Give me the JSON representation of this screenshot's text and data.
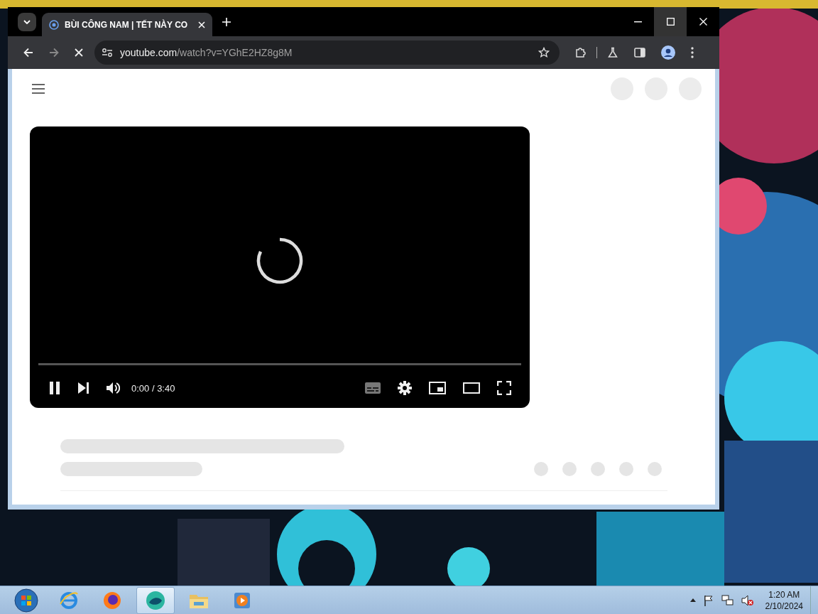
{
  "browser": {
    "tab": {
      "title": "BÙI CÔNG NAM | TẾT NÀY CO",
      "selected": true
    },
    "address": {
      "domain": "youtube.com",
      "path": "/watch?v=YGhE2HZ8g8M"
    },
    "loading": true
  },
  "player": {
    "time": "0:00 / 3:40",
    "playing": true
  },
  "taskbar": {
    "apps": [
      {
        "kind": "ie",
        "selected": false
      },
      {
        "kind": "firefox",
        "selected": false
      },
      {
        "kind": "browser",
        "selected": true
      },
      {
        "kind": "folder",
        "selected": false
      },
      {
        "kind": "media",
        "selected": false
      }
    ],
    "clock": {
      "time": "1:20 AM",
      "date": "2/10/2024"
    }
  }
}
